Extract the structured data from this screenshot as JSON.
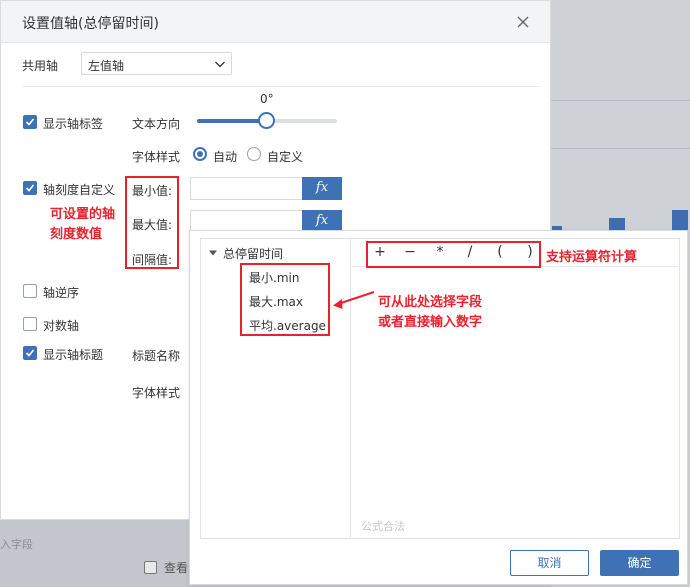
{
  "dialog": {
    "title": "设置值轴(总停留时间)"
  },
  "shared_axis": {
    "label": "共用轴",
    "selected": "左值轴"
  },
  "show_axis_label": {
    "label": "显示轴标签",
    "checked": true,
    "text_direction_label": "文本方向",
    "angle": "0°",
    "font_style_label": "字体样式",
    "radio_auto": "自动",
    "radio_custom": "自定义"
  },
  "axis_scale": {
    "label": "轴刻度自定义",
    "checked": true,
    "min_label": "最小值:",
    "max_label": "最大值:",
    "interval_label": "间隔值:",
    "fx": "fx",
    "annotation_line1": "可设置的轴",
    "annotation_line2": "刻度数值"
  },
  "axis_reverse": {
    "label": "轴逆序",
    "checked": false
  },
  "log_axis": {
    "label": "对数轴",
    "checked": false
  },
  "show_axis_title": {
    "label": "显示轴标题",
    "checked": true,
    "title_name_label": "标题名称",
    "font_style_label": "字体样式"
  },
  "formula_popup": {
    "tree_root": "总停留时间",
    "tree_items": [
      "最小.min",
      "最大.max",
      "平均.average"
    ],
    "operators": [
      "+",
      "−",
      "*",
      "/",
      "(",
      ")"
    ],
    "operators_annotation": "支持运算符计算",
    "field_annotation_line1": "可从此处选择字段",
    "field_annotation_line2": "或者直接输入数字",
    "status": "公式合法",
    "cancel_label": "取消",
    "ok_label": "确定"
  },
  "background": {
    "hint_text": "入字段",
    "view_label": "查看"
  },
  "colors": {
    "accent": "#3f72b5",
    "annotation": "#e8232f"
  }
}
